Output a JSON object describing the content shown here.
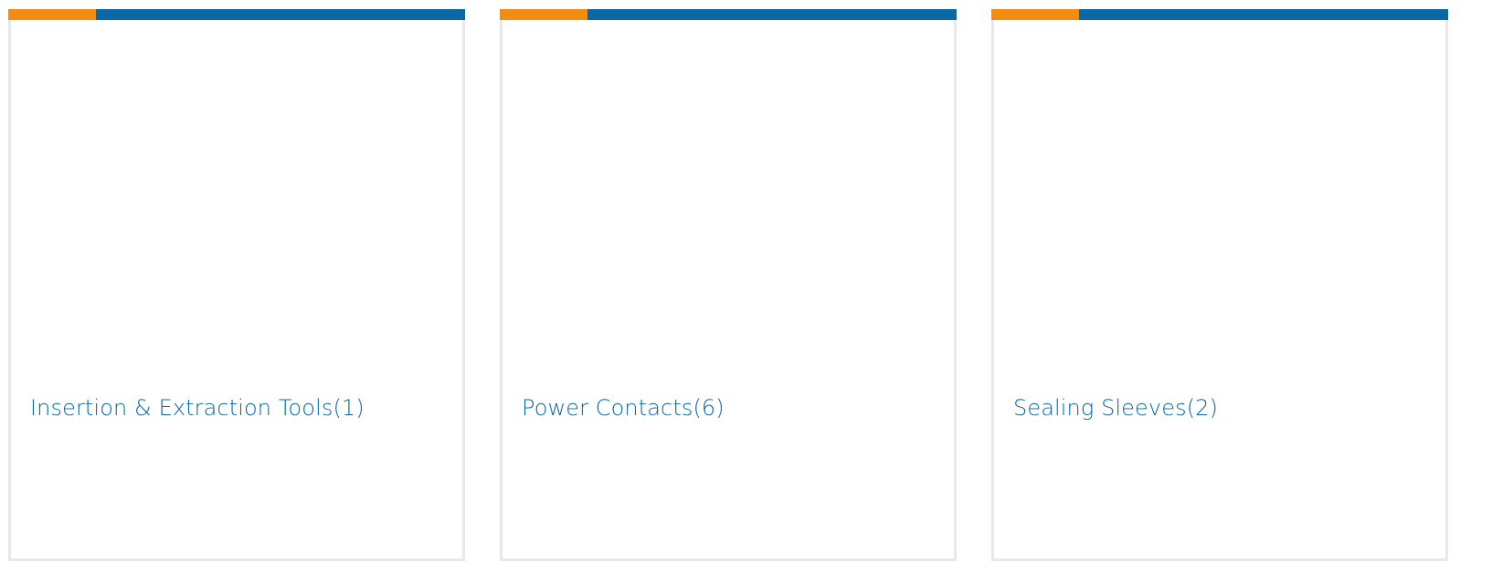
{
  "colors": {
    "accent_orange": "#f28c13",
    "accent_blue": "#0b68a4",
    "link_blue": "#0b68a4",
    "card_border": "#e8e8e8"
  },
  "cards": [
    {
      "title": "Insertion & Extraction Tools(1)"
    },
    {
      "title": "Power Contacts(6)"
    },
    {
      "title": "Sealing Sleeves(2)"
    }
  ]
}
